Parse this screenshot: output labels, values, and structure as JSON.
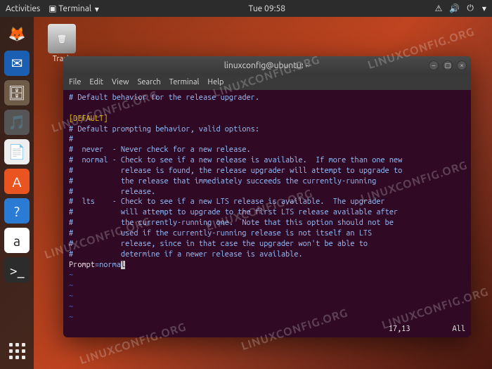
{
  "topbar": {
    "activities": "Activities",
    "app_indicator": "Terminal",
    "clock": "Tue 09:58"
  },
  "desktop": {
    "trash_label": "Trash"
  },
  "dock_items": [
    {
      "name": "firefox-icon",
      "glyph": "🦊",
      "bg": "transparent"
    },
    {
      "name": "thunderbird-icon",
      "glyph": "✉",
      "bg": "#1b5fb3"
    },
    {
      "name": "files-icon",
      "glyph": "🗄",
      "bg": "#6e5b4a"
    },
    {
      "name": "rhythmbox-icon",
      "glyph": "🎵",
      "bg": "#555"
    },
    {
      "name": "libreoffice-icon",
      "glyph": "📄",
      "bg": "#eee"
    },
    {
      "name": "software-icon",
      "glyph": "A",
      "bg": "#e95420"
    },
    {
      "name": "help-icon",
      "glyph": "?",
      "bg": "#2a7bd4"
    },
    {
      "name": "amazon-icon",
      "glyph": "a",
      "bg": "#fff"
    },
    {
      "name": "terminal-icon",
      "glyph": ">_",
      "bg": "#2c2c2c"
    }
  ],
  "terminal": {
    "title": "linuxconfig@ubuntu: ~",
    "menu": [
      "File",
      "Edit",
      "View",
      "Search",
      "Terminal",
      "Help"
    ],
    "lines": [
      {
        "t": "comment",
        "text": "# Default behavior for the release upgrader."
      },
      {
        "t": "blank",
        "text": ""
      },
      {
        "t": "section",
        "text": "[DEFAULT]"
      },
      {
        "t": "comment",
        "text": "# Default prompting behavior, valid options:"
      },
      {
        "t": "comment",
        "text": "#"
      },
      {
        "t": "comment",
        "text": "#  never  - Never check for a new release."
      },
      {
        "t": "comment",
        "text": "#  normal - Check to see if a new release is available.  If more than one new"
      },
      {
        "t": "comment",
        "text": "#           release is found, the release upgrader will attempt to upgrade to"
      },
      {
        "t": "comment",
        "text": "#           the release that immediately succeeds the currently-running"
      },
      {
        "t": "comment",
        "text": "#           release."
      },
      {
        "t": "comment",
        "text": "#  lts    - Check to see if a new LTS release is available.  The upgrader"
      },
      {
        "t": "comment",
        "text": "#           will attempt to upgrade to the first LTS release available after"
      },
      {
        "t": "comment",
        "text": "#           the currently-running one.  Note that this option should not be"
      },
      {
        "t": "comment",
        "text": "#           used if the currently-running release is not itself an LTS"
      },
      {
        "t": "comment",
        "text": "#           release, since in that case the upgrader won't be able to"
      },
      {
        "t": "comment",
        "text": "#           determine if a newer release is available."
      }
    ],
    "setting_key": "Prompt",
    "setting_value": "normal",
    "cursor_pos": "17,13",
    "scroll": "All"
  },
  "watermark": "LINUXCONFIG.ORG"
}
